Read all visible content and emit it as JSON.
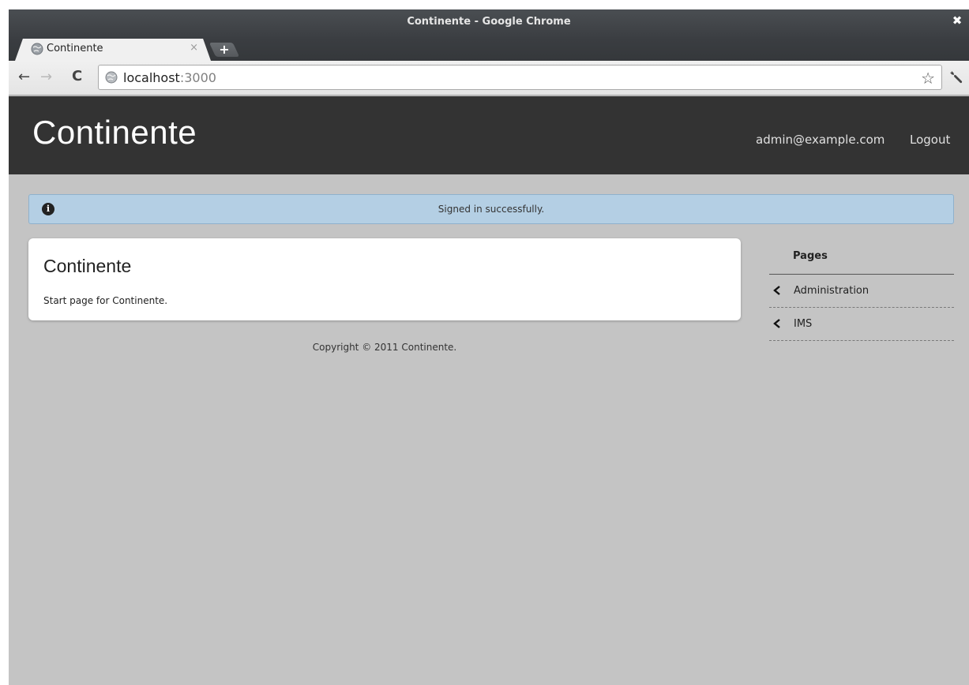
{
  "window": {
    "title": "Continente - Google Chrome",
    "close_glyph": "✖"
  },
  "tab": {
    "title": "Continente",
    "close_glyph": "×",
    "new_tab_glyph": "+"
  },
  "toolbar": {
    "back_glyph": "←",
    "forward_glyph": "→",
    "reload_glyph": "C",
    "url_host": "localhost",
    "url_port": ":3000",
    "star_glyph": "☆"
  },
  "header": {
    "brand": "Continente",
    "user_email": "admin@example.com",
    "logout_label": "Logout"
  },
  "flash": {
    "icon_glyph": "i",
    "message": "Signed in successfully."
  },
  "content": {
    "title": "Continente",
    "text": "Start page for Continente."
  },
  "footer": {
    "copyright": "Copyright © 2011 Continente."
  },
  "sidebar": {
    "heading": "Pages",
    "items": [
      {
        "label": "Administration"
      },
      {
        "label": "IMS"
      }
    ]
  }
}
